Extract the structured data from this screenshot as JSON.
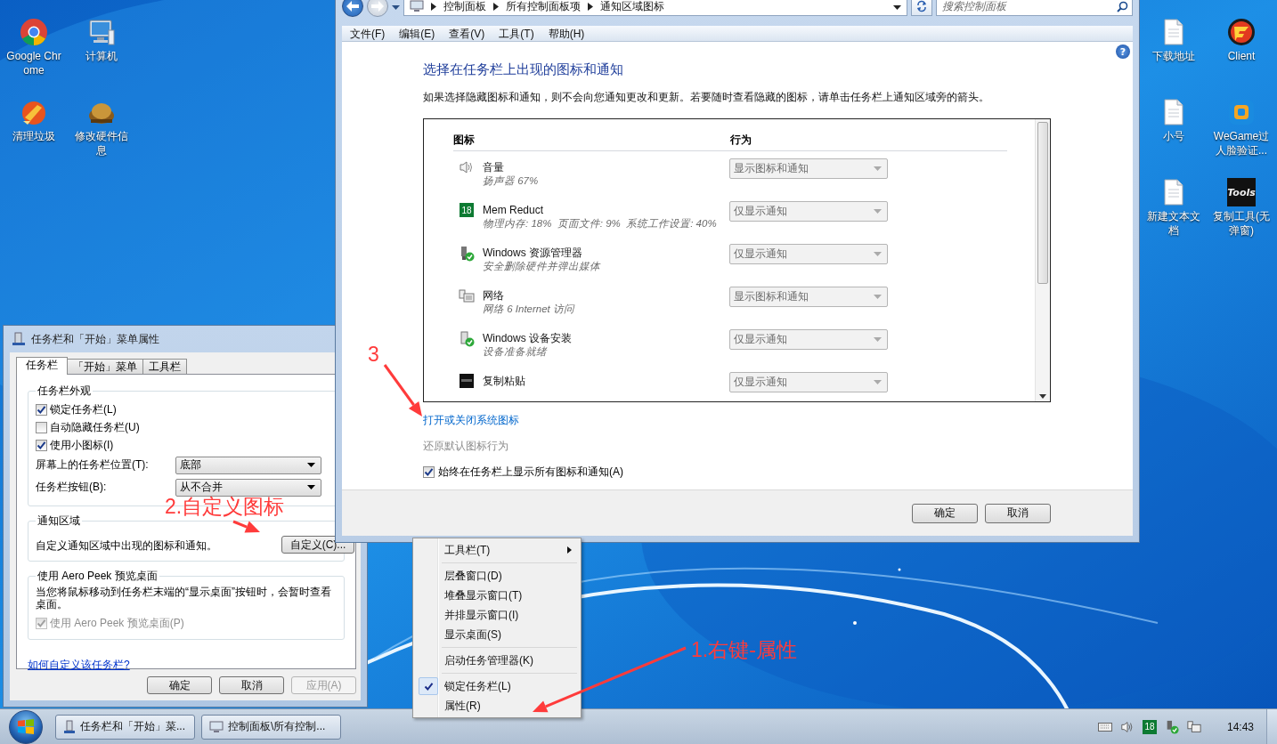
{
  "desktop": {
    "icons_left": [
      {
        "label": "Google Chrome",
        "kind": "chrome"
      },
      {
        "label": "计算机",
        "kind": "computer"
      },
      {
        "label": "清理垃圾",
        "kind": "cleaner"
      },
      {
        "label": "修改硬件信息",
        "kind": "hardware"
      }
    ],
    "icons_right": [
      {
        "label": "下载地址",
        "kind": "document"
      },
      {
        "label": "Client",
        "kind": "client"
      },
      {
        "label": "小号",
        "kind": "document"
      },
      {
        "label": "WeGame过人脸验证...",
        "kind": "wegame"
      },
      {
        "label": "新建文本文档",
        "kind": "document"
      },
      {
        "label": "复制工具(无弹窗)",
        "kind": "tools"
      }
    ],
    "tools_logo_text": "Tools"
  },
  "control_panel": {
    "breadcrumb": [
      "控制面板",
      "所有控制面板项",
      "通知区域图标"
    ],
    "search": {
      "placeholder": "搜索控制面板"
    },
    "menu": [
      "文件(F)",
      "编辑(E)",
      "查看(V)",
      "工具(T)",
      "帮助(H)"
    ],
    "help_icon": "?",
    "heading": "选择在任务栏上出现的图标和通知",
    "description": "如果选择隐藏图标和通知，则不会向您通知更改和更新。若要随时查看隐藏的图标，请单击任务栏上通知区域旁的箭头。",
    "columns": [
      "图标",
      "行为"
    ],
    "rows": [
      {
        "kind": "speaker",
        "name": "音量",
        "detail": "扬声器 67%",
        "behavior": "显示图标和通知"
      },
      {
        "kind": "memory",
        "badge": "18",
        "name": "Mem Reduct",
        "detail": "物理内存: 18%  页面文件: 9%  系统工作设置: 40%",
        "behavior": "仅显示通知"
      },
      {
        "kind": "usb",
        "name": "Windows 资源管理器",
        "detail": "安全删除硬件并弹出媒体",
        "behavior": "仅显示通知"
      },
      {
        "kind": "network",
        "name": "网络",
        "detail": "网络 6 Internet 访问",
        "behavior": "显示图标和通知"
      },
      {
        "kind": "device",
        "name": "Windows 设备安装",
        "detail": "设备准备就绪",
        "behavior": "仅显示通知"
      },
      {
        "kind": "tools",
        "name": "复制粘贴",
        "behavior": "仅显示通知"
      }
    ],
    "links": [
      {
        "label": "打开或关闭系统图标",
        "disabled": false
      },
      {
        "label": "还原默认图标行为",
        "disabled": true
      }
    ],
    "always_show": {
      "label": "始终在任务栏上显示所有图标和通知(A)",
      "checked": true
    },
    "buttons": [
      "确定",
      "取消"
    ]
  },
  "dialog": {
    "title": "任务栏和「开始」菜单属性",
    "tabs": [
      {
        "label": "任务栏",
        "selected": true
      },
      {
        "label": "「开始」菜单",
        "selected": false
      },
      {
        "label": "工具栏",
        "selected": false
      }
    ],
    "appearance": {
      "title": "任务栏外观",
      "checkboxes": [
        {
          "label": "锁定任务栏(L)",
          "checked": true
        },
        {
          "label": "自动隐藏任务栏(U)",
          "checked": false
        },
        {
          "label": "使用小图标(I)",
          "checked": true
        }
      ],
      "dropdowns": [
        {
          "label": "屏幕上的任务栏位置(T):",
          "value": "底部"
        },
        {
          "label": "任务栏按钮(B):",
          "value": "从不合并"
        }
      ]
    },
    "notification": {
      "title": "通知区域",
      "text": "自定义通知区域中出现的图标和通知。",
      "button": "自定义(C)..."
    },
    "aero_peek": {
      "title": "使用 Aero Peek 预览桌面",
      "text": "当您将鼠标移动到任务栏末端的“显示桌面”按钮时，会暂时查看桌面。",
      "checkbox": {
        "label": "使用 Aero Peek 预览桌面(P)",
        "checked": true,
        "disabled": true
      }
    },
    "help_link": "如何自定义该任务栏?",
    "buttons": [
      {
        "label": "确定",
        "disabled": false
      },
      {
        "label": "取消",
        "disabled": false
      },
      {
        "label": "应用(A)",
        "disabled": true
      }
    ]
  },
  "context_menu": {
    "items": [
      {
        "kind": "submenu",
        "label": "工具栏(T)",
        "checked": false
      },
      {
        "kind": "separator"
      },
      {
        "kind": "item",
        "label": "层叠窗口(D)",
        "checked": false
      },
      {
        "kind": "item",
        "label": "堆叠显示窗口(T)",
        "checked": false
      },
      {
        "kind": "item",
        "label": "并排显示窗口(I)",
        "checked": false
      },
      {
        "kind": "item",
        "label": "显示桌面(S)",
        "checked": false
      },
      {
        "kind": "separator"
      },
      {
        "kind": "item",
        "label": "启动任务管理器(K)",
        "checked": false
      },
      {
        "kind": "separator"
      },
      {
        "kind": "item",
        "label": "锁定任务栏(L)",
        "checked": true
      },
      {
        "kind": "item",
        "label": "属性(R)",
        "checked": false
      }
    ]
  },
  "taskbar": {
    "tasks": [
      {
        "label": "任务栏和「开始」菜...",
        "kind": "dialog"
      },
      {
        "label": "控制面板\\所有控制...",
        "kind": "explorer"
      }
    ],
    "tray": {
      "badge": "18",
      "clock": "14:43"
    }
  },
  "annotations": [
    {
      "text": "3"
    },
    {
      "text": "2.自定义图标"
    },
    {
      "text": "1.右键-属性"
    }
  ]
}
